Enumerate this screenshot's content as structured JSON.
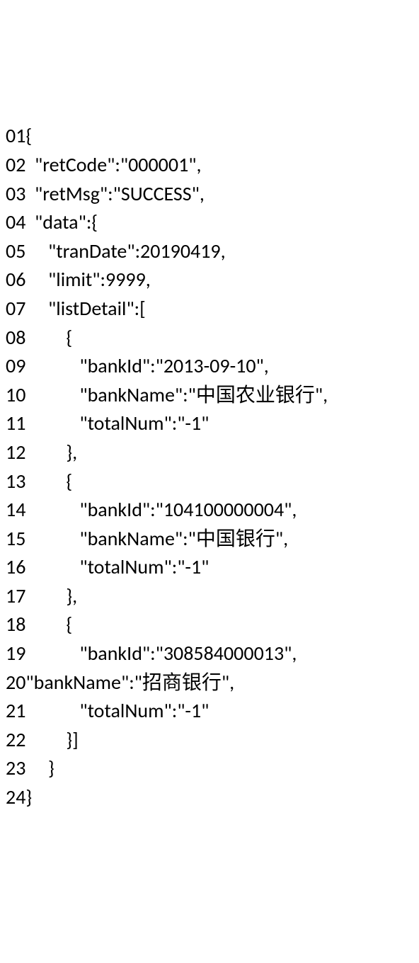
{
  "lines": [
    {
      "num": "01",
      "text": "{"
    },
    {
      "num": "02",
      "text": "  \"retCode\":\"000001\","
    },
    {
      "num": "03",
      "text": "  \"retMsg\":\"SUCCESS\","
    },
    {
      "num": "04",
      "text": "  \"data\":{"
    },
    {
      "num": "05",
      "text": "     \"tranDate\":20190419,"
    },
    {
      "num": "06",
      "text": "     \"limit\":9999,"
    },
    {
      "num": "07",
      "text": "     \"listDetail\":["
    },
    {
      "num": "08",
      "text": "         {"
    },
    {
      "num": "09",
      "text": "            \"bankId\":\"2013-09-10\","
    },
    {
      "num": "10",
      "text": "            \"bankName\":\"中国农业银行\","
    },
    {
      "num": "11",
      "text": "            \"totalNum\":\"-1\""
    },
    {
      "num": "12",
      "text": "         },"
    },
    {
      "num": "13",
      "text": "         {"
    },
    {
      "num": "14",
      "text": "            \"bankId\":\"104100000004\","
    },
    {
      "num": "15",
      "text": "            \"bankName\":\"中国银行\","
    },
    {
      "num": "16",
      "text": "            \"totalNum\":\"-1\""
    },
    {
      "num": "17",
      "text": "         },"
    },
    {
      "num": "18",
      "text": "         {"
    },
    {
      "num": "19",
      "text": "            \"bankId\":\"308584000013\","
    },
    {
      "num": "20",
      "text": "\"bankName\":\"招商银行\","
    },
    {
      "num": "21",
      "text": "            \"totalNum\":\"-1\""
    },
    {
      "num": "22",
      "text": "         }]"
    },
    {
      "num": "23",
      "text": "     }"
    },
    {
      "num": "24",
      "text": "}"
    }
  ]
}
